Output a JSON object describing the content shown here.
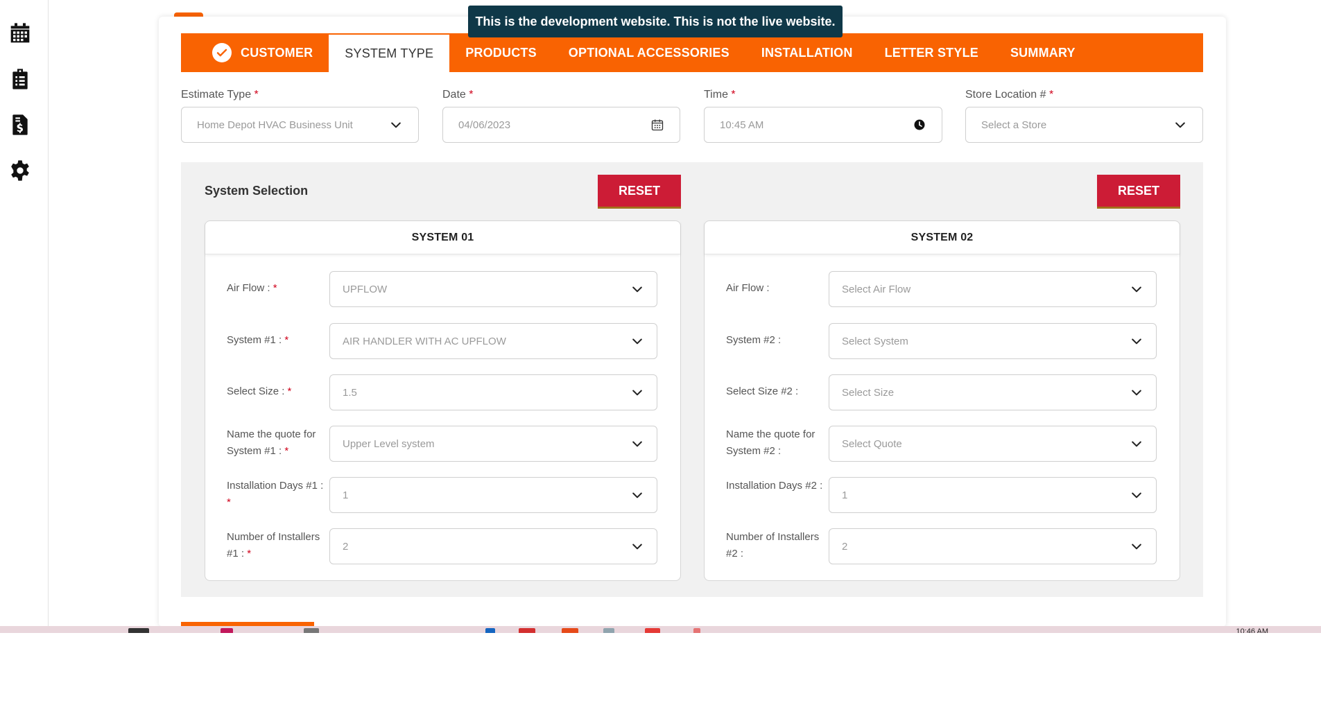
{
  "banner": "This is the development website. This is not the live website.",
  "sidebar": {
    "icons": [
      "calendar-icon",
      "clipboard-list-icon",
      "invoice-dollar-icon",
      "gear-icon"
    ]
  },
  "steps": [
    {
      "label": "CUSTOMER",
      "state": "done"
    },
    {
      "label": "SYSTEM TYPE",
      "state": "active"
    },
    {
      "label": "PRODUCTS",
      "state": "todo"
    },
    {
      "label": "OPTIONAL ACCESSORIES",
      "state": "todo"
    },
    {
      "label": "INSTALLATION",
      "state": "todo"
    },
    {
      "label": "LETTER STYLE",
      "state": "todo"
    },
    {
      "label": "SUMMARY",
      "state": "todo"
    }
  ],
  "form": {
    "estimate_type": {
      "label": "Estimate Type",
      "required": "*",
      "value": "Home Depot HVAC Business Unit"
    },
    "date": {
      "label": "Date",
      "required": "*",
      "value": "04/06/2023"
    },
    "time": {
      "label": "Time",
      "required": "*",
      "value": "10:45 AM"
    },
    "store": {
      "label": "Store Location #",
      "required": "*",
      "placeholder": "Select a Store"
    }
  },
  "selection": {
    "title": "System Selection",
    "reset_label": "RESET",
    "systems": [
      {
        "title": "SYSTEM 01",
        "rows": [
          {
            "label": "Air Flow :",
            "req": "*",
            "value": "UPFLOW"
          },
          {
            "label": "System #1 :",
            "req": "*",
            "value": "AIR HANDLER WITH AC UPFLOW"
          },
          {
            "label": "Select Size :",
            "req": "*",
            "value": "1.5"
          },
          {
            "label": "Name the quote for System #1 :",
            "req": "*",
            "value": "Upper Level system"
          },
          {
            "label": "Installation Days #1 :",
            "req": "*",
            "value": "1"
          },
          {
            "label": "Number of Installers #1 :",
            "req": "*",
            "value": "2"
          }
        ]
      },
      {
        "title": "SYSTEM 02",
        "rows": [
          {
            "label": "Air Flow :",
            "req": "",
            "value": "Select Air Flow"
          },
          {
            "label": "System #2 :",
            "req": "",
            "value": "Select System"
          },
          {
            "label": "Select Size #2 :",
            "req": "",
            "value": "Select Size"
          },
          {
            "label": "Name the quote for System #2 :",
            "req": "",
            "value": "Select Quote"
          },
          {
            "label": "Installation Days #2 :",
            "req": "",
            "value": "1"
          },
          {
            "label": "Number of Installers #2 :",
            "req": "",
            "value": "2"
          }
        ]
      }
    ]
  },
  "taskbar": {
    "clock": "10:46 AM"
  },
  "colors": {
    "brand": "#f96302",
    "reset": "#cc1c36",
    "banner": "#0f3848"
  }
}
